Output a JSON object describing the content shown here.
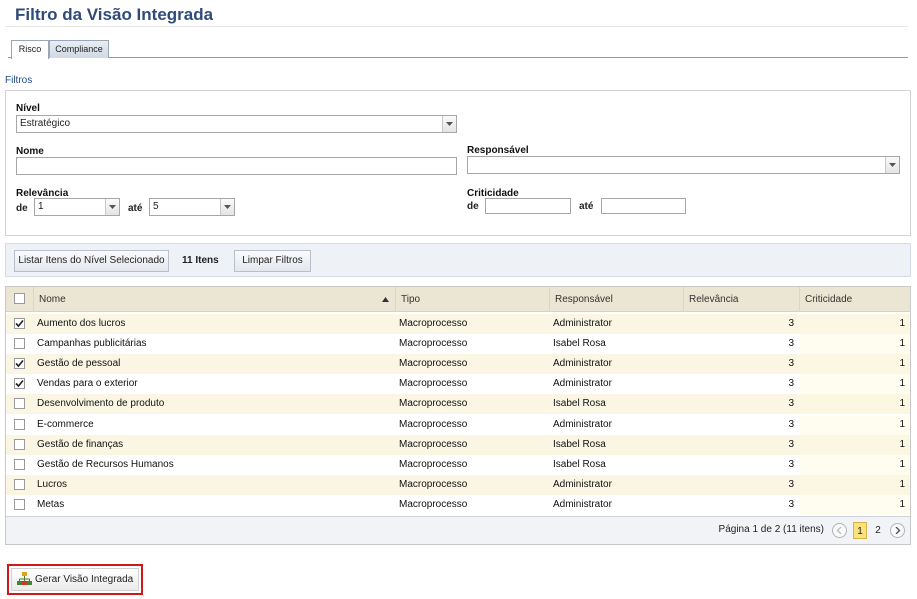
{
  "page": {
    "title": "Filtro da Visão Integrada"
  },
  "tabs": [
    {
      "label": "Risco",
      "active": true
    },
    {
      "label": "Compliance",
      "active": false
    }
  ],
  "filters": {
    "section_label": "Filtros",
    "nivel": {
      "label": "Nível",
      "value": "Estratégico"
    },
    "nome": {
      "label": "Nome",
      "value": ""
    },
    "responsavel": {
      "label": "Responsável",
      "value": ""
    },
    "relevancia": {
      "label": "Relevância",
      "from_label": "de",
      "from_value": "1",
      "to_label": "até",
      "to_value": "5"
    },
    "criticidade": {
      "label": "Criticidade",
      "from_label": "de",
      "from_value": "",
      "to_label": "até",
      "to_value": ""
    }
  },
  "toolbar": {
    "list_button": "Listar Itens do Nível Selecionado",
    "count_label": "11 Itens",
    "clear_button": "Limpar Filtros"
  },
  "grid": {
    "columns": [
      "Nome",
      "Tipo",
      "Responsável",
      "Relevância",
      "Criticidade"
    ],
    "rows": [
      {
        "checked": true,
        "nome": "Aumento dos lucros",
        "tipo": "Macroprocesso",
        "responsavel": "Administrator",
        "relevancia": "3",
        "criticidade": "1"
      },
      {
        "checked": false,
        "nome": "Campanhas publicitárias",
        "tipo": "Macroprocesso",
        "responsavel": "Isabel Rosa",
        "relevancia": "3",
        "criticidade": "1"
      },
      {
        "checked": true,
        "nome": "Gestão de pessoal",
        "tipo": "Macroprocesso",
        "responsavel": "Administrator",
        "relevancia": "3",
        "criticidade": "1"
      },
      {
        "checked": true,
        "nome": "Vendas para o exterior",
        "tipo": "Macroprocesso",
        "responsavel": "Administrator",
        "relevancia": "3",
        "criticidade": "1"
      },
      {
        "checked": false,
        "nome": "Desenvolvimento de produto",
        "tipo": "Macroprocesso",
        "responsavel": "Isabel Rosa",
        "relevancia": "3",
        "criticidade": "1"
      },
      {
        "checked": false,
        "nome": "E-commerce",
        "tipo": "Macroprocesso",
        "responsavel": "Administrator",
        "relevancia": "3",
        "criticidade": "1"
      },
      {
        "checked": false,
        "nome": "Gestão de finanças",
        "tipo": "Macroprocesso",
        "responsavel": "Isabel Rosa",
        "relevancia": "3",
        "criticidade": "1"
      },
      {
        "checked": false,
        "nome": "Gestão de Recursos Humanos",
        "tipo": "Macroprocesso",
        "responsavel": "Isabel Rosa",
        "relevancia": "3",
        "criticidade": "1"
      },
      {
        "checked": false,
        "nome": "Lucros",
        "tipo": "Macroprocesso",
        "responsavel": "Administrator",
        "relevancia": "3",
        "criticidade": "1"
      },
      {
        "checked": false,
        "nome": "Metas",
        "tipo": "Macroprocesso",
        "responsavel": "Administrator",
        "relevancia": "3",
        "criticidade": "1"
      }
    ],
    "pagination": {
      "text": "Página 1 de 2 (11 itens)",
      "pages": [
        "1",
        "2"
      ],
      "current": "1"
    }
  },
  "actions": {
    "generate_button": "Gerar Visão Integrada"
  },
  "colors": {
    "title": "#2f4b7a",
    "highlight_border": "#d01818",
    "row_alt": "#faf6e3"
  }
}
